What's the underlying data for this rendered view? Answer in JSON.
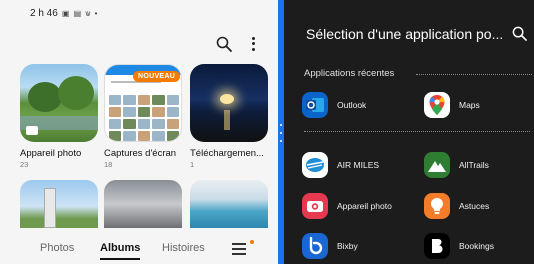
{
  "status_bar": {
    "time": "2 h 46",
    "icons": "▣ ▤ ѡ •"
  },
  "gallery": {
    "albums": [
      {
        "name": "Appareil photo",
        "count": "23"
      },
      {
        "name": "Captures d'écran",
        "count": "18",
        "badge": "NOUVEAU"
      },
      {
        "name": "Téléchargemen...",
        "count": "1"
      }
    ],
    "bottom_nav": {
      "items": [
        "Photos",
        "Albums",
        "Histoires"
      ],
      "active": "Albums"
    }
  },
  "app_picker": {
    "title": "Sélection d'une application po...",
    "recent_label": "Applications récentes",
    "recent_apps": [
      {
        "label": "Outlook",
        "icon": "outlook-icon",
        "color": "#0a64c9"
      },
      {
        "label": "Maps",
        "icon": "maps-icon",
        "color": "#ffffff"
      }
    ],
    "all_apps": [
      {
        "label": "AIR MILES",
        "icon": "airmiles-icon",
        "color": "#ffffff"
      },
      {
        "label": "AllTrails",
        "icon": "alltrails-icon",
        "color": "#2e7d32"
      },
      {
        "label": "Appareil photo",
        "icon": "camera-icon",
        "color": "#e53950"
      },
      {
        "label": "Astuces",
        "icon": "tips-icon",
        "color": "#f57c28"
      },
      {
        "label": "Bixby",
        "icon": "bixby-icon",
        "color": "#1a66d2"
      },
      {
        "label": "Bookings",
        "icon": "bookings-icon",
        "color": "#000000"
      }
    ]
  },
  "colors": {
    "divider": "#1a73e8",
    "accent_orange": "#f57c00",
    "dark_bg": "#1c1c1c"
  }
}
